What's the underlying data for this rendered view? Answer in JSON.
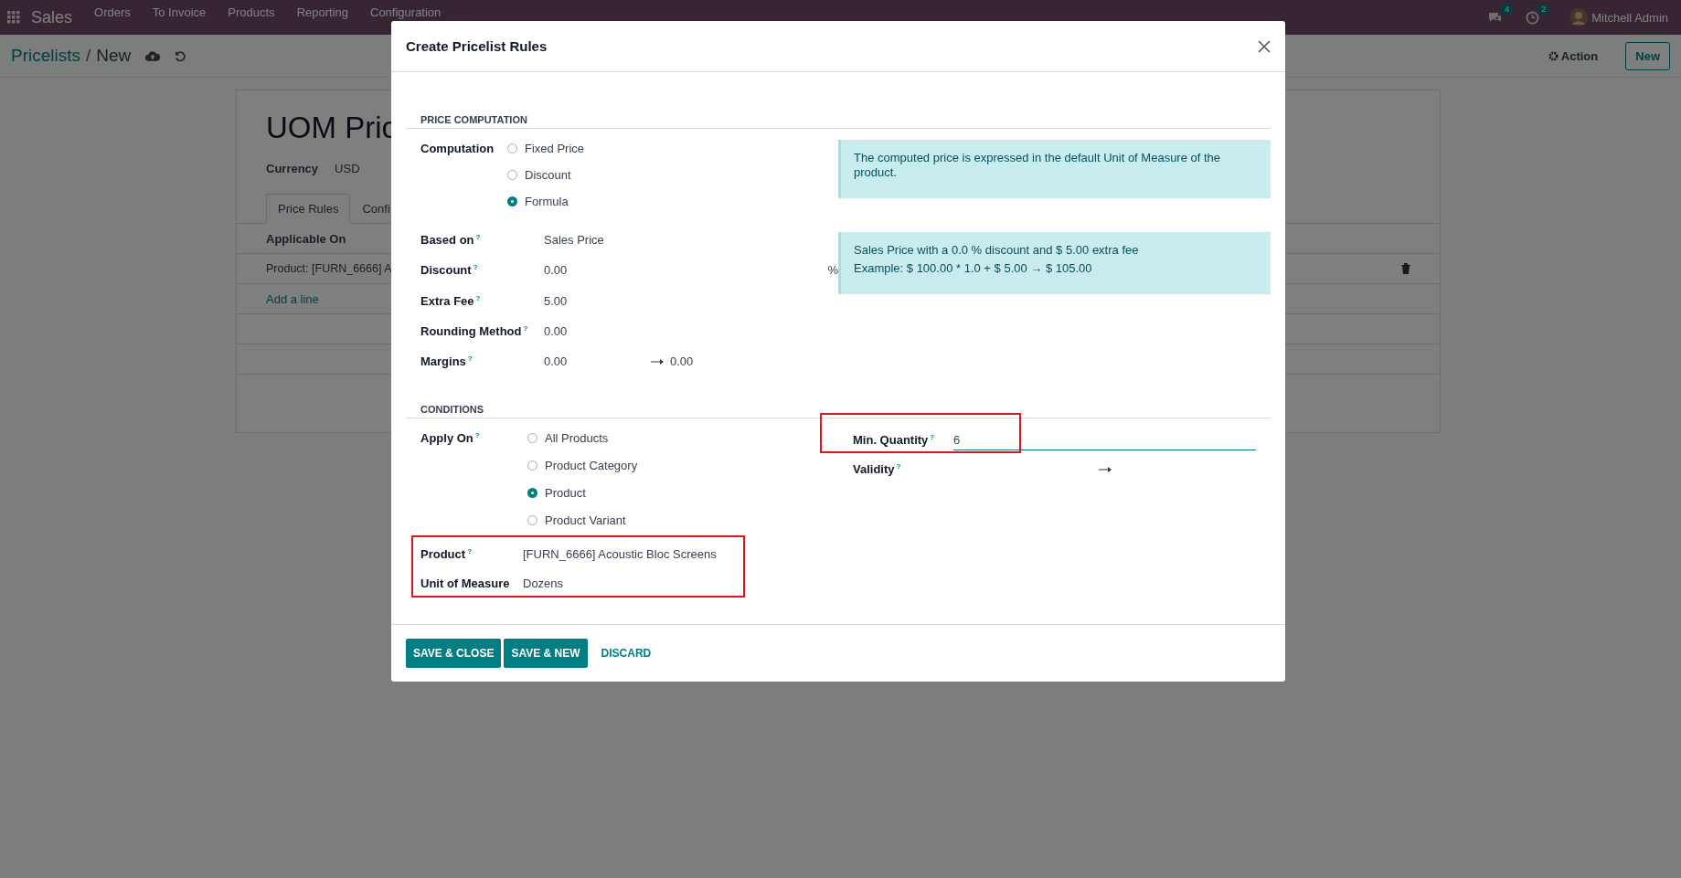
{
  "navbar": {
    "app": "Sales",
    "menu": [
      "Orders",
      "To Invoice",
      "Products",
      "Reporting",
      "Configuration"
    ],
    "messages_badge": "4",
    "activities_badge": "2",
    "user": "Mitchell Admin"
  },
  "control_panel": {
    "breadcrumb": [
      {
        "label": "Pricelists",
        "kind": "link"
      },
      {
        "label": "New",
        "kind": "current"
      }
    ],
    "separator": "/",
    "action": "Action",
    "new_button": "New"
  },
  "form": {
    "title": "UOM Pric",
    "currency_label": "Currency",
    "currency": "USD",
    "tabs": [
      {
        "label": "Price Rules",
        "selected": true
      },
      {
        "label": "Confi",
        "selected": false
      }
    ],
    "list": {
      "column": "Applicable On",
      "rows": [
        "Product: [FURN_6666] A"
      ],
      "add_line": "Add a line"
    }
  },
  "dialog": {
    "title": "Create Pricelist Rules",
    "price_computation": {
      "heading": "PRICE COMPUTATION",
      "computation": {
        "label": "Computation",
        "options": [
          {
            "label": "Fixed Price",
            "selected": false
          },
          {
            "label": "Discount",
            "selected": false
          },
          {
            "label": "Formula",
            "selected": true
          }
        ]
      },
      "fields": [
        {
          "kind": "text",
          "label": "Based on",
          "help": "?",
          "value": "Sales Price"
        },
        {
          "kind": "percent",
          "label": "Discount",
          "help": "?",
          "value": "0.00",
          "suffix": "%"
        },
        {
          "kind": "text",
          "label": "Extra Fee",
          "help": "?",
          "value": "5.00"
        },
        {
          "kind": "text",
          "label": "Rounding Method",
          "help": "?",
          "value": "0.00"
        },
        {
          "kind": "range",
          "label": "Margins",
          "help": "?",
          "value": "0.00",
          "value_to": "0.00"
        }
      ],
      "notes": [
        [
          "The computed price is expressed in the default Unit of Measure of the product."
        ],
        [
          "Sales Price with a 0.0 % discount and $ 5.00 extra fee",
          "Example: $ 100.00 * 1.0 + $ 5.00 → $ 105.00"
        ]
      ]
    },
    "conditions": {
      "heading": "CONDITIONS",
      "apply_on": {
        "label": "Apply On",
        "help": "?",
        "options": [
          {
            "label": "All Products",
            "selected": false
          },
          {
            "label": "Product Category",
            "selected": false
          },
          {
            "label": "Product",
            "selected": true
          },
          {
            "label": "Product Variant",
            "selected": false
          }
        ]
      },
      "product_highlighted": true,
      "product_fields": [
        {
          "label": "Product",
          "help": "?",
          "value": "[FURN_6666] Acoustic Bloc Screens"
        },
        {
          "label": "Unit of Measure",
          "value": "Dozens"
        }
      ],
      "min_quantity": {
        "label": "Min. Quantity",
        "help": "?",
        "value": "6",
        "highlighted": true
      },
      "validity": {
        "label": "Validity",
        "help": "?"
      }
    },
    "buttons": [
      {
        "label": "SAVE & CLOSE",
        "kind": "primary"
      },
      {
        "label": "SAVE & NEW",
        "kind": "primary"
      },
      {
        "label": "DISCARD",
        "kind": "link"
      }
    ]
  }
}
